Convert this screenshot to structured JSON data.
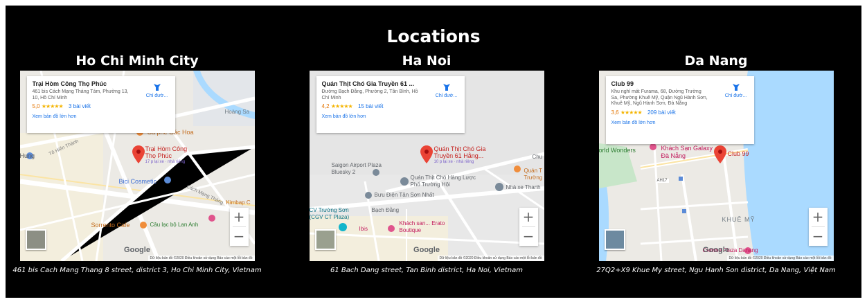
{
  "page": {
    "title": "Locations"
  },
  "locations": [
    {
      "city": "Ho Chi Minh City",
      "place": "Trại Hòm Công Thọ Phúc",
      "place_address": "461 bis Cách Mạng Tháng Tám, Phường 13, 10, Hồ Chí Minh",
      "rating": "5,0",
      "stars": "★★★★★",
      "reviews": "3 bài viết",
      "directions": "Chỉ đườ...",
      "larger_map": "Xem bản đồ lớn hơn",
      "marker_label": "Trại Hòm Công Thọ Phúc",
      "marker_sub": "17 p lại xe · nhà riêng",
      "map_labels": [
        "Cà phê Gác Hoa",
        "Bici Cosmetic",
        "Sorrento Cafe",
        "Câu lạc bộ Lan Anh",
        "Hoàng Sa",
        "Kimbap C",
        "Cách Mạng Tháng",
        "Tô Hiến Thành",
        "Hung"
      ],
      "map_footer": "Dữ liệu bản đồ ©2020   Điều khoản sử dụng   Báo cáo một lỗi bản đồ",
      "address": "461 bis Cach Mang Thang 8 street, district 3, Ho Chi Minh City, Vietnam"
    },
    {
      "city": "Ha Noi",
      "place": "Quán Thịt Chó Gia Truyền 61 ...",
      "place_address": "Đường Bạch Đằng, Phường 2, Tân Bình, Hồ Chí Minh",
      "rating": "4,2",
      "stars": "★★★★★",
      "reviews": "15 bài viết",
      "directions": "Chỉ đườ...",
      "larger_map": "Xem bản đồ lớn hơn",
      "marker_label": "Quán Thịt Chó Gia Truyền 61 Hằng...",
      "marker_sub": "10 p lại xe · nhà riêng",
      "map_labels": [
        "Saigon Airport Plaza Bluesky 2",
        "Quán Thịt Chó Hàng Lược Phố Trường Hội",
        "Bưu Điện Tân Sơn Nhất",
        "Nhà xe Thanh",
        "Bạch Đằng",
        "Khách san... Erato Boutique",
        "Ibis",
        "CV Trường Sơn (CGV CT Plaza)",
        "Quán T Trường",
        "Chu"
      ],
      "map_footer": "Dữ liệu bản đồ ©2020   Điều khoản sử dụng   Báo cáo một lỗi bản đồ",
      "address": "61 Bach Dang street, Tan Binh district, Ha Noi, Vietnam"
    },
    {
      "city": "Da Nang",
      "place": "Club 99",
      "place_address": "Khu nghỉ mát Furama, 68, Đường Trường Sa, Phường Khuê Mỹ, Quận Ngũ Hành Sơn, Khuê Mỹ, Ngũ Hành Sơn, Đà Nẵng",
      "rating": "3,6",
      "stars": "★★★★★",
      "reviews": "209 bài viết",
      "directions": "Chỉ đườ...",
      "larger_map": "Xem bản đồ lớn hơn",
      "marker_label": "Club 99",
      "marker_sub": "",
      "map_labels": [
        "Khách Sạn Galaxy Đà Nẵng",
        "orld Wonders",
        "KHUÊ MỸ",
        "AH17",
        "Crowne Plaza Danang"
      ],
      "map_footer": "Dữ liệu bản đồ ©2020   Điều khoản sử dụng   Báo cáo một lỗi bản đồ",
      "address": "27Q2+X9 Khue My street, Ngu Hanh Son district, Da Nang, Việt Nam"
    }
  ],
  "map_ui": {
    "zoom_in": "+",
    "zoom_out": "−",
    "brand": "Google"
  },
  "colors": {
    "marker": "#ea4335",
    "water": "#aadaff",
    "road": "#ffffff",
    "land": "#eceae5",
    "link": "#1a73e8"
  }
}
